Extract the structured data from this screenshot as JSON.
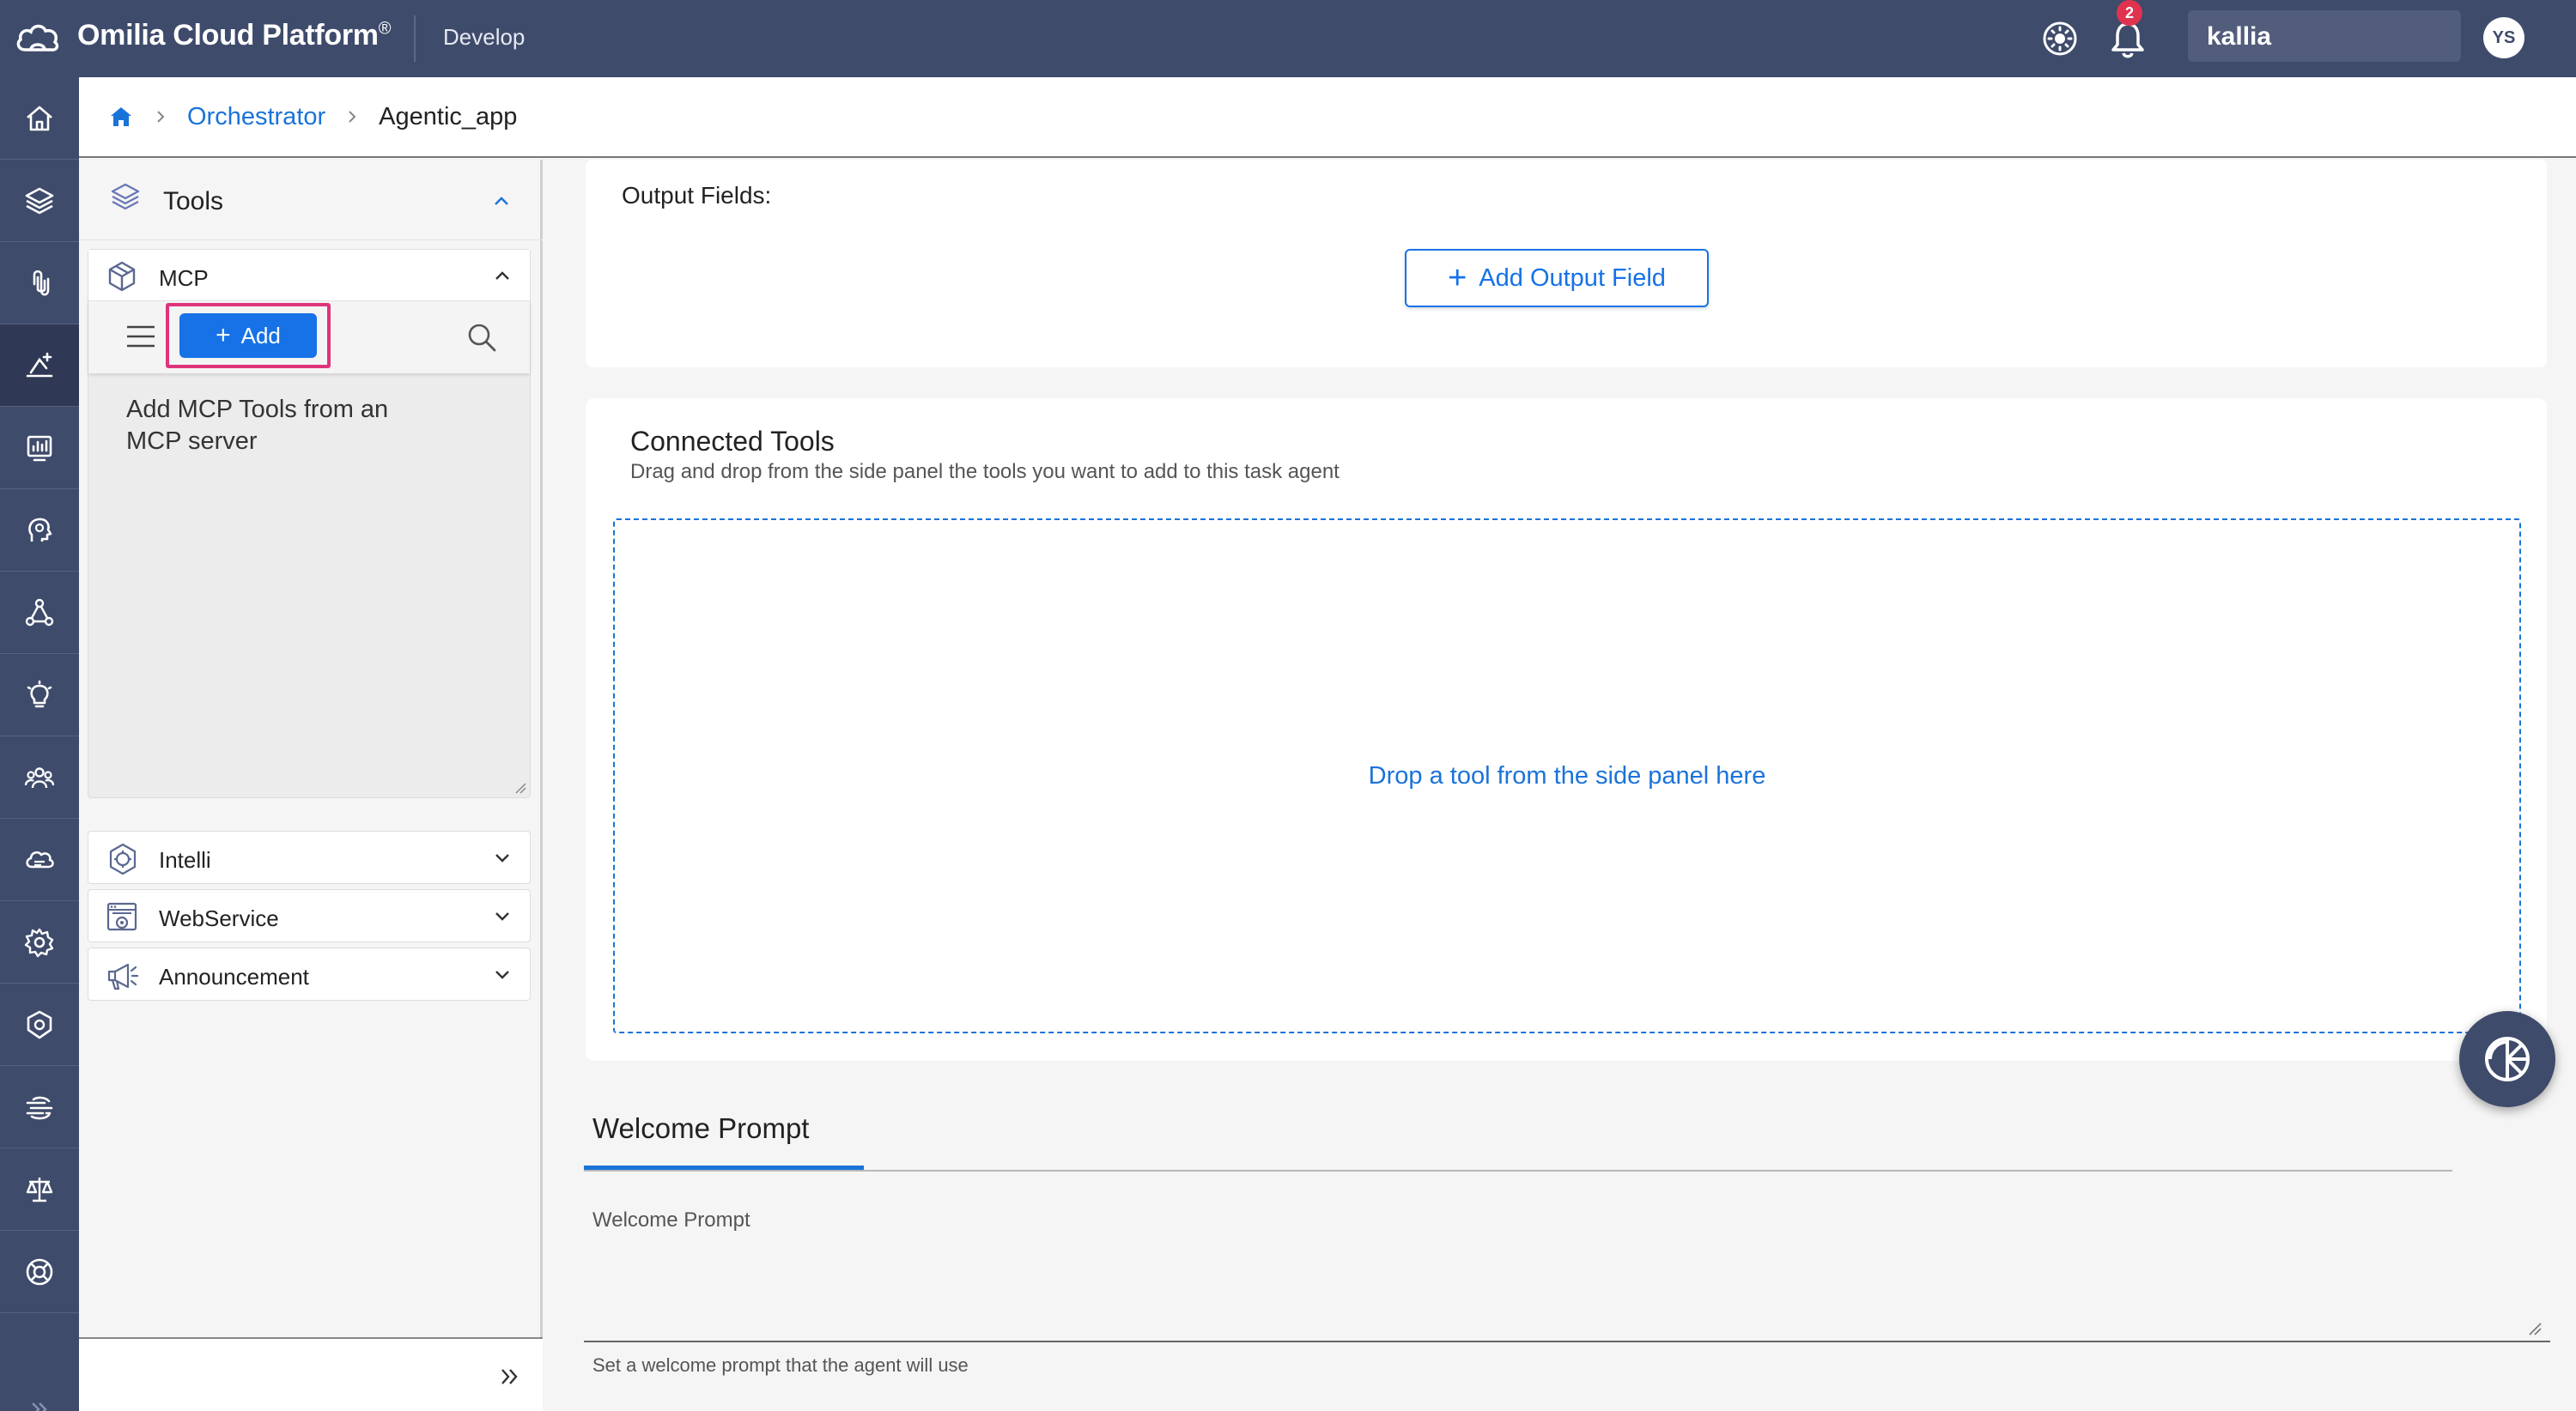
{
  "header": {
    "brand": "Omilia Cloud Platform",
    "brand_mark": "®",
    "environment": "Develop",
    "notification_count": "2",
    "user_name": "kallia",
    "avatar_initials": "YS"
  },
  "rail": {
    "icons": [
      "home-icon",
      "layers-icon",
      "paperclip-icon",
      "orchestrator-icon",
      "analytics-icon",
      "head-icon",
      "network-icon",
      "lightbulb-icon",
      "group-icon",
      "cloud-icon",
      "gear-icon",
      "shield-icon",
      "speed-icon",
      "scale-icon",
      "help-icon"
    ],
    "active_index": 3
  },
  "breadcrumb": {
    "items": [
      "Orchestrator",
      "Agentic_app"
    ]
  },
  "tools_panel": {
    "title": "Tools",
    "mcp": {
      "label": "MCP",
      "add_label": "Add",
      "empty_text": "Add MCP Tools from an MCP server"
    },
    "sections": [
      {
        "label": "Intelli",
        "icon": "intelli-icon"
      },
      {
        "label": "WebService",
        "icon": "webservice-icon"
      },
      {
        "label": "Announcement",
        "icon": "announcement-icon"
      }
    ]
  },
  "main": {
    "output_fields_label": "Output Fields:",
    "add_output_field_label": "Add Output Field",
    "connected_tools": {
      "title": "Connected Tools",
      "subtitle": "Drag and drop from the side panel the tools you want to add to this task agent",
      "dropzone_text": "Drop a tool from the side panel here"
    },
    "welcome": {
      "tab_label": "Welcome Prompt",
      "field_placeholder": "Welcome Prompt",
      "helper_text": "Set a welcome prompt that the agent will use"
    }
  },
  "colors": {
    "topbar": "#3f4b6b",
    "accent": "#1672e6",
    "highlight": "#e0347a",
    "badge": "#e0334f"
  }
}
